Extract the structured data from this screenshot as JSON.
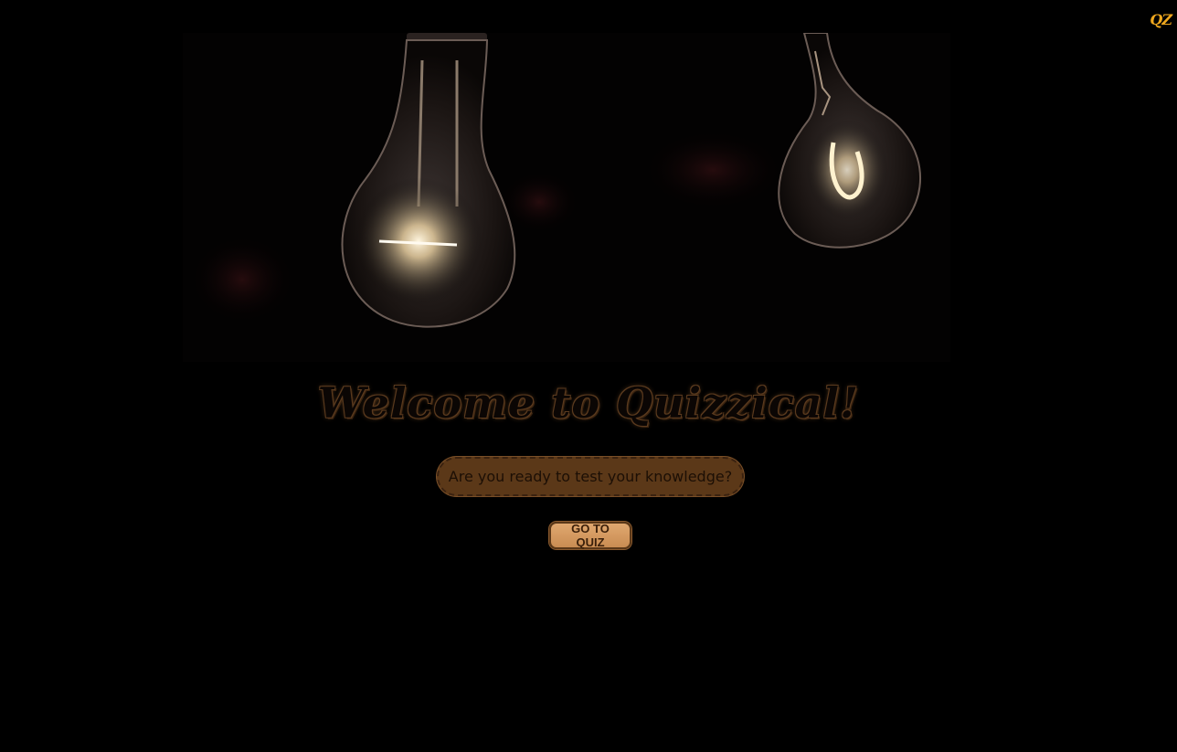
{
  "app": {
    "logo_text": "QZ"
  },
  "hero": {
    "image_name": "light-bulbs-photo"
  },
  "main": {
    "title": "Welcome to Quizzical!",
    "subtitle": "Are you ready to test your knowledge?",
    "cta_label": "GO TO QUIZ"
  },
  "colors": {
    "background": "#000000",
    "logo": "#f0a81e",
    "accent_brown": "#5b3818",
    "button_fill": "#d69a5e"
  }
}
